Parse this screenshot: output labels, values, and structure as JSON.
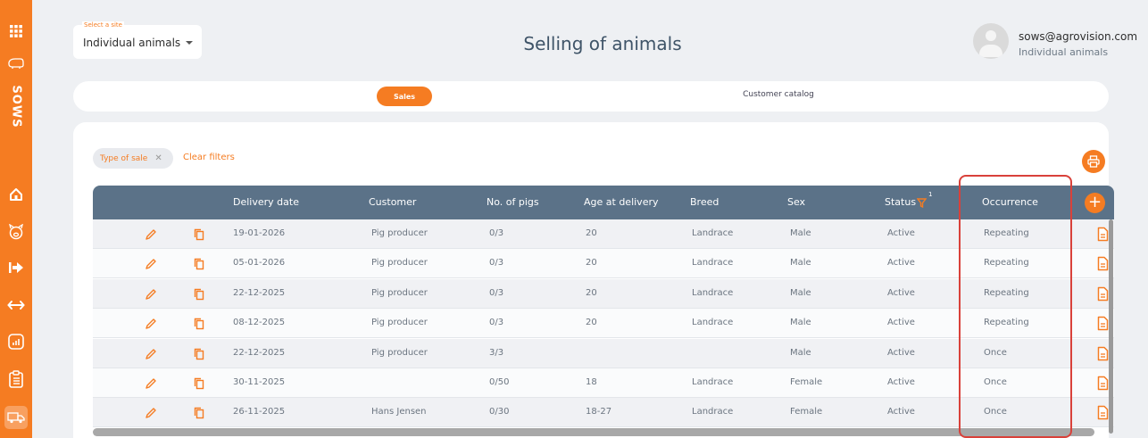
{
  "sidebar": {
    "app_name": "SOWS",
    "icons": [
      "apps-grid-icon",
      "pig-icon",
      "home-icon",
      "piglet-icon",
      "arrow-right-icon",
      "transfer-icon",
      "analytics-icon",
      "clipboard-icon",
      "truck-icon"
    ]
  },
  "site_select": {
    "label": "Select a site",
    "value": "Individual animals"
  },
  "page": {
    "title": "Selling of animals"
  },
  "user": {
    "email": "sows@agrovision.com",
    "site": "Individual animals"
  },
  "tabs": [
    {
      "label": "Sales",
      "active": true
    },
    {
      "label": "Customer catalog",
      "active": false
    }
  ],
  "filters": {
    "chip_label": "Type of sale",
    "clear_label": "Clear filters"
  },
  "table": {
    "headers": {
      "delivery_date": "Delivery date",
      "customer": "Customer",
      "no_of_pigs": "No. of pigs",
      "age_at_delivery": "Age at delivery",
      "breed": "Breed",
      "sex": "Sex",
      "status": "Status",
      "status_filter_count": "1",
      "occurrence": "Occurrence"
    },
    "rows": [
      {
        "delivery_date": "19-01-2026",
        "customer": "Pig producer",
        "no_of_pigs": "0/3",
        "age_at_delivery": "20",
        "breed": "Landrace",
        "sex": "Male",
        "status": "Active",
        "occurrence": "Repeating"
      },
      {
        "delivery_date": "05-01-2026",
        "customer": "Pig producer",
        "no_of_pigs": "0/3",
        "age_at_delivery": "20",
        "breed": "Landrace",
        "sex": "Male",
        "status": "Active",
        "occurrence": "Repeating"
      },
      {
        "delivery_date": "22-12-2025",
        "customer": "Pig producer",
        "no_of_pigs": "0/3",
        "age_at_delivery": "20",
        "breed": "Landrace",
        "sex": "Male",
        "status": "Active",
        "occurrence": "Repeating"
      },
      {
        "delivery_date": "08-12-2025",
        "customer": "Pig producer",
        "no_of_pigs": "0/3",
        "age_at_delivery": "20",
        "breed": "Landrace",
        "sex": "Male",
        "status": "Active",
        "occurrence": "Repeating"
      },
      {
        "delivery_date": "22-12-2025",
        "customer": "Pig producer",
        "no_of_pigs": "3/3",
        "age_at_delivery": "",
        "breed": "",
        "sex": "Male",
        "status": "Active",
        "occurrence": "Once"
      },
      {
        "delivery_date": "30-11-2025",
        "customer": "",
        "no_of_pigs": "0/50",
        "age_at_delivery": "18",
        "breed": "Landrace",
        "sex": "Female",
        "status": "Active",
        "occurrence": "Once"
      },
      {
        "delivery_date": "26-11-2025",
        "customer": "Hans Jensen",
        "no_of_pigs": "0/30",
        "age_at_delivery": "18-27",
        "breed": "Landrace",
        "sex": "Female",
        "status": "Active",
        "occurrence": "Once"
      }
    ]
  },
  "colors": {
    "accent": "#f57c22",
    "header": "#5b7288",
    "title": "#3f5468",
    "highlight": "#d9413a"
  }
}
